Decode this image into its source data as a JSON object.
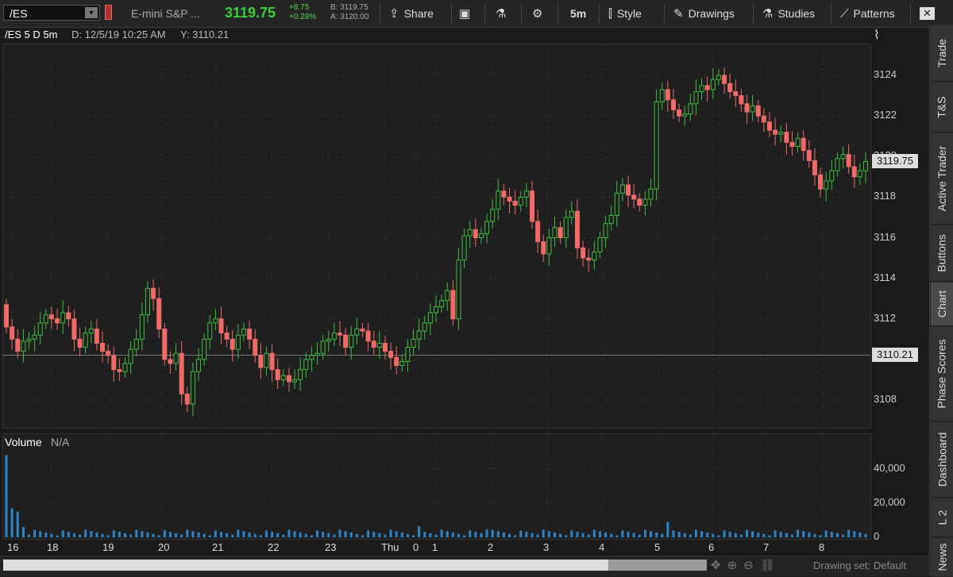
{
  "toolbar": {
    "symbol": "/ES",
    "description": "E-mini S&P ...",
    "last_price": "3119.75",
    "change_abs": "+8.75",
    "change_pct": "+0.28%",
    "bid": "B: 3119.75",
    "ask": "A: 3120.00",
    "share_label": "Share",
    "timeframe_label": "5m",
    "style_label": "Style",
    "drawings_label": "Drawings",
    "studies_label": "Studies",
    "patterns_label": "Patterns"
  },
  "chart_header": {
    "symbol_label": "/ES 5 D 5m",
    "date_label": "D: 12/5/19 10:25 AM",
    "y_label": "Y: 3110.21"
  },
  "price_axis": [
    "3124",
    "3122",
    "3120",
    "3118",
    "3116",
    "3114",
    "3112",
    "3110",
    "3108"
  ],
  "price_tags": {
    "last": "3119.75",
    "cursor": "3110.21"
  },
  "volume": {
    "title": "Volume",
    "value": "N/A",
    "axis": [
      "40,000",
      "20,000",
      "0"
    ]
  },
  "x_axis": [
    "16",
    "18",
    "19",
    "20",
    "21",
    "22",
    "23",
    "Thu",
    "0",
    "1",
    "2",
    "3",
    "4",
    "5",
    "6",
    "7",
    "8"
  ],
  "right_tabs": [
    "Trade",
    "T&S",
    "Active Trader",
    "Buttons",
    "Chart",
    "Phase Scores",
    "Dashboard",
    "L 2",
    "News"
  ],
  "bottom": {
    "drawing_set": "Drawing set: Default"
  },
  "colors": {
    "up": "#3fbf3f",
    "down": "#f06a6a",
    "volume": "#2a86c8",
    "price_green": "#37d037"
  },
  "chart_data": {
    "type": "candlestick",
    "ylim": [
      3107,
      3126
    ],
    "x_labels": [
      "16",
      "18",
      "19",
      "20",
      "21",
      "22",
      "23",
      "Thu",
      "0",
      "1",
      "2",
      "3",
      "4",
      "5",
      "6",
      "7",
      "8"
    ],
    "close": [
      3111.6,
      3111.0,
      3110.4,
      3110.9,
      3111.0,
      3111.2,
      3111.8,
      3112.2,
      3112.0,
      3111.8,
      3112.3,
      3112.0,
      3111.0,
      3110.6,
      3111.3,
      3111.5,
      3110.8,
      3110.4,
      3110.2,
      3109.5,
      3109.4,
      3109.8,
      3110.5,
      3111.0,
      3112.2,
      3113.5,
      3113.0,
      3111.5,
      3110.0,
      3109.8,
      3110.3,
      3108.3,
      3107.8,
      3109.4,
      3110.0,
      3111.0,
      3111.8,
      3112.0,
      3111.3,
      3111.0,
      3110.5,
      3111.2,
      3111.5,
      3111.0,
      3110.2,
      3109.6,
      3110.3,
      3109.5,
      3109.0,
      3109.2,
      3108.9,
      3109.0,
      3109.5,
      3110.0,
      3110.2,
      3110.3,
      3110.9,
      3111.0,
      3111.3,
      3111.2,
      3110.6,
      3111.2,
      3111.5,
      3111.4,
      3110.9,
      3110.6,
      3110.8,
      3110.4,
      3110.1,
      3109.7,
      3109.9,
      3110.6,
      3111.0,
      3111.4,
      3111.8,
      3112.3,
      3112.6,
      3112.9,
      3113.4,
      3112.0,
      3114.9,
      3116.1,
      3116.4,
      3116.0,
      3116.2,
      3116.8,
      3117.4,
      3118.3,
      3118.0,
      3117.8,
      3117.6,
      3118.0,
      3118.3,
      3116.8,
      3115.8,
      3115.2,
      3116.0,
      3116.5,
      3116.0,
      3117.0,
      3117.3,
      3115.5,
      3115.0,
      3114.9,
      3115.3,
      3116.0,
      3116.7,
      3117.1,
      3118.2,
      3118.6,
      3118.1,
      3117.9,
      3117.6,
      3117.9,
      3118.4,
      3122.7,
      3123.3,
      3122.8,
      3122.3,
      3122.0,
      3122.1,
      3122.6,
      3123.2,
      3123.5,
      3123.3,
      3123.8,
      3124.0,
      3123.6,
      3123.2,
      3123.0,
      3122.6,
      3122.2,
      3122.5,
      3122.0,
      3121.7,
      3121.3,
      3121.1,
      3121.2,
      3120.7,
      3120.5,
      3120.9,
      3120.3,
      3119.8,
      3119.1,
      3118.4,
      3118.8,
      3119.3,
      3119.9,
      3120.1,
      3119.5,
      3119.0,
      3119.3,
      3119.75
    ]
  }
}
